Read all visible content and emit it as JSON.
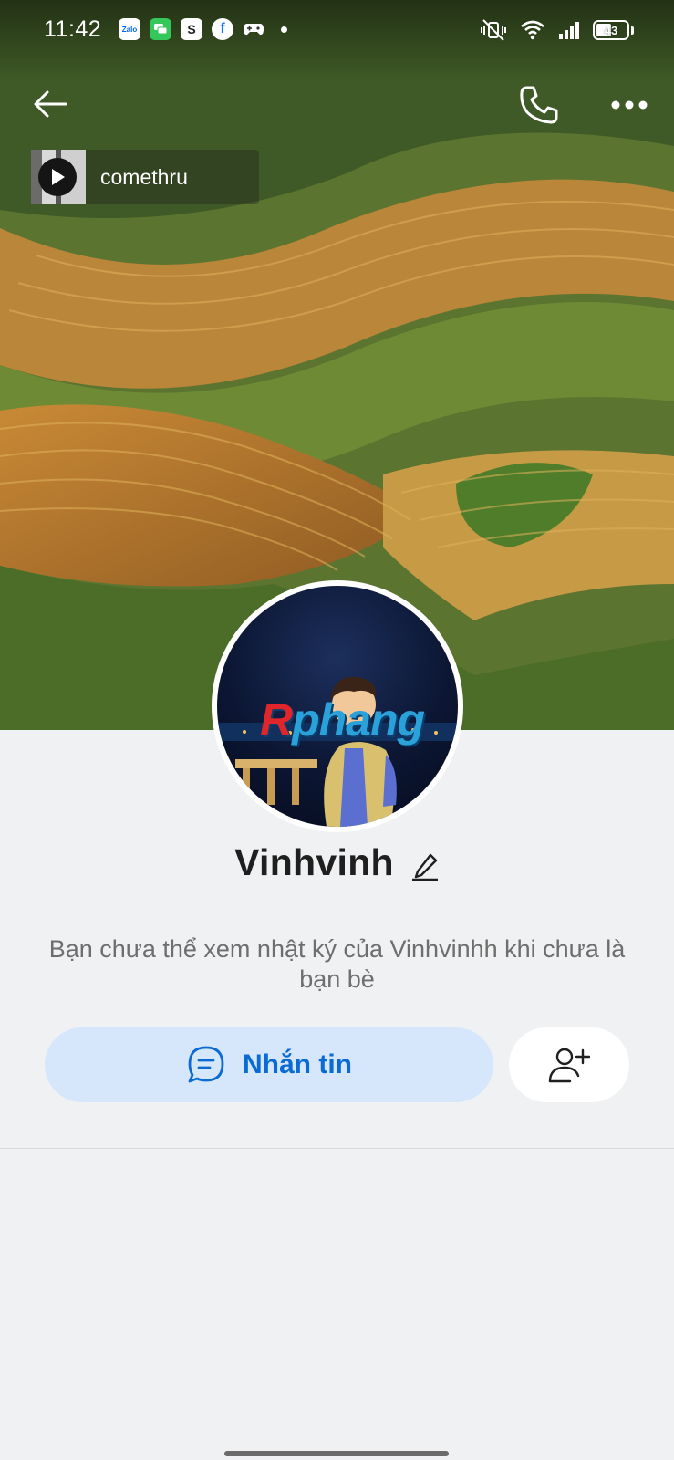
{
  "status_bar": {
    "time": "11:42",
    "apps": [
      "zalo-icon",
      "messages-icon",
      "shopee-icon",
      "facebook-icon",
      "game-controller-icon"
    ],
    "zalo_text": "Zalo",
    "shop_text": "S",
    "fb_text": "f",
    "battery_level": "43"
  },
  "music": {
    "title": "comethru"
  },
  "avatar": {
    "logo_r": "R",
    "logo_rest": "phang"
  },
  "profile": {
    "name": "Vinhvinh"
  },
  "info": {
    "message": "Bạn chưa thể xem nhật ký của Vinhvinhh khi chưa là bạn bè"
  },
  "actions": {
    "message_label": "Nhắn tin"
  },
  "colors": {
    "accent": "#0b6bd4",
    "accent_soft": "#d7e7fb",
    "background": "#eff1f3"
  }
}
